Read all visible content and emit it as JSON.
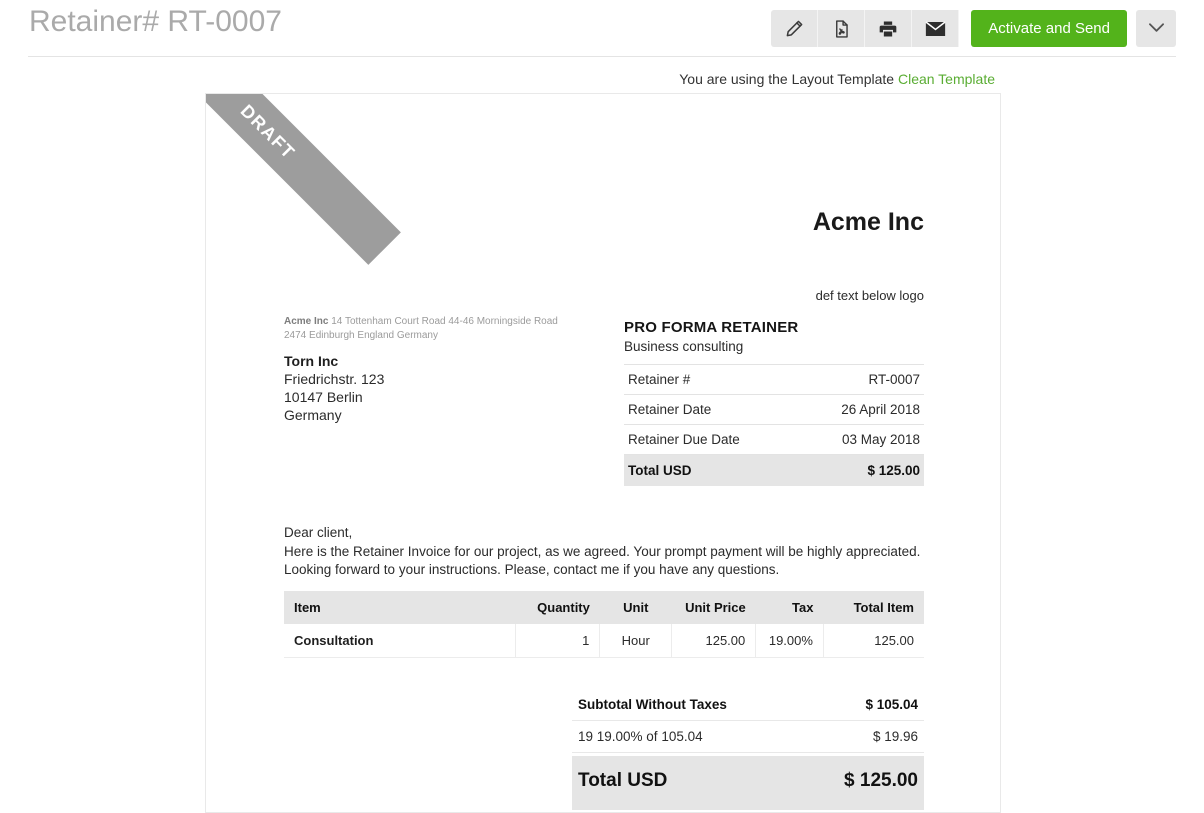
{
  "header": {
    "title": "Retainer# RT-0007",
    "toolbar": {
      "edit_label": "pencil-icon",
      "pdf_label": "pdf-icon",
      "print_label": "printer-icon",
      "email_label": "envelope-icon",
      "activate_label": "Activate and Send",
      "caret_label": "chevron-down-icon",
      "accent_color": "#53b31b",
      "button_bg": "#e6e6e6"
    }
  },
  "template_notice": {
    "text": "You are using the Layout Template",
    "link": "Clean Template",
    "link_color": "#5aad33"
  },
  "document": {
    "ribbon": "DRAFT",
    "ribbon_color": "#9d9d9d",
    "logo": "Acme Inc",
    "logo_subtext": "def text below logo",
    "sender": {
      "name": "Acme Inc",
      "address": "14 Tottenham Court Road 44-46 Morningside Road 2474 Edinburgh England Germany"
    },
    "recipient": {
      "name": "Torn Inc",
      "street": "Friedrichstr. 123",
      "city": "10147 Berlin",
      "country": "Germany"
    },
    "meta": {
      "title": "PRO FORMA RETAINER",
      "subtitle": "Business consulting",
      "rows": [
        {
          "label": "Retainer #",
          "value": "RT-0007"
        },
        {
          "label": "Retainer Date",
          "value": "26 April 2018"
        },
        {
          "label": "Retainer Due Date",
          "value": "03 May 2018"
        }
      ],
      "total_label": "Total USD",
      "total_value": "$ 125.00"
    },
    "message": {
      "greeting": "Dear client,",
      "line1": "Here is the Retainer Invoice for our project, as we agreed. Your prompt payment will be highly appreciated.",
      "line2": "Looking forward to your instructions. Please, contact me if you have any questions."
    },
    "items": {
      "columns": [
        "Item",
        "Quantity",
        "Unit",
        "Unit Price",
        "Tax",
        "Total Item"
      ],
      "rows": [
        {
          "item": "Consultation",
          "quantity": "1",
          "unit": "Hour",
          "unit_price": "125.00",
          "tax": "19.00%",
          "total_item": "125.00"
        }
      ]
    },
    "totals": {
      "subtotal_label": "Subtotal Without Taxes",
      "subtotal_value": "$ 105.04",
      "tax_label": "19 19.00% of 105.04",
      "tax_value": "$ 19.96",
      "grand_label": "Total USD",
      "grand_value": "$ 125.00"
    }
  }
}
